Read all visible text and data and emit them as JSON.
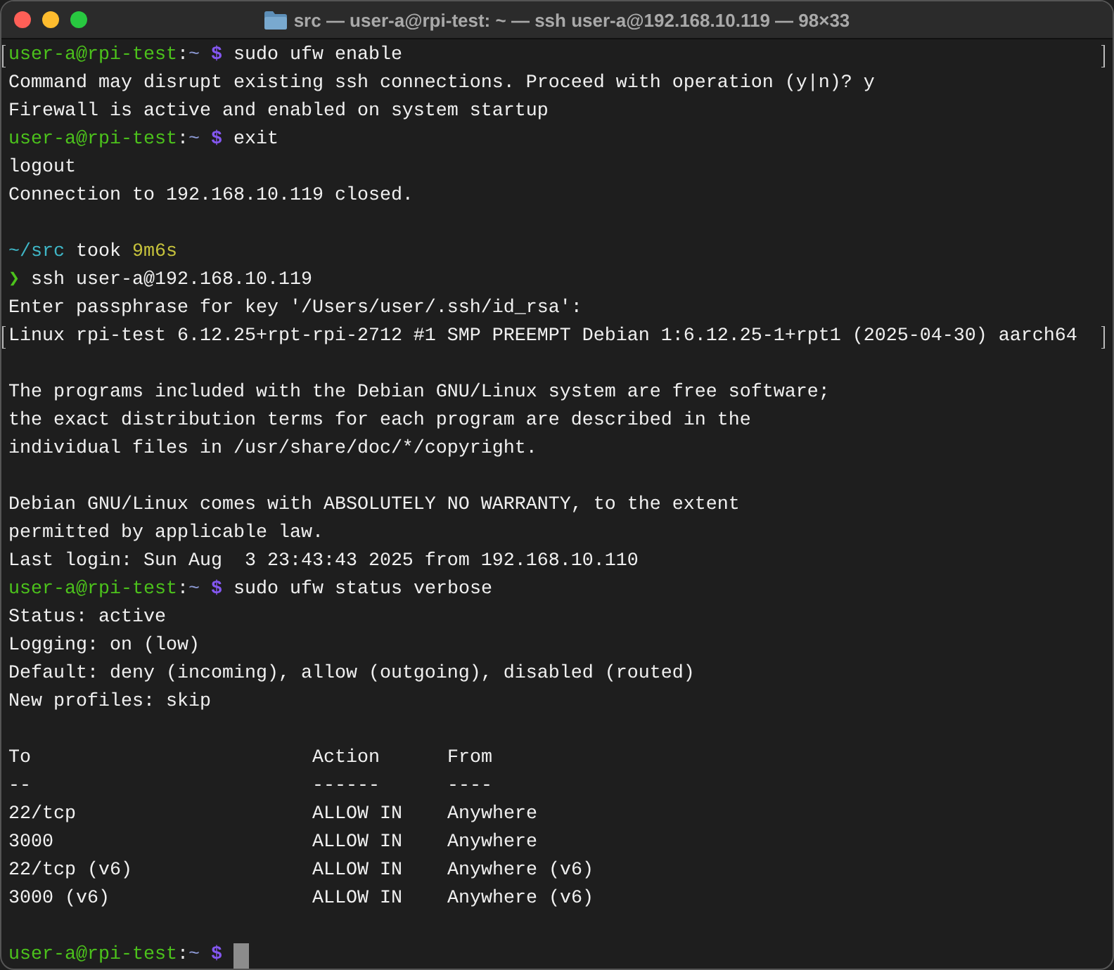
{
  "window": {
    "title": "src — user-a@rpi-test: ~ — ssh user-a@192.168.10.119 — 98×33"
  },
  "blocks": [
    {
      "kind": "text",
      "lines": [
        {
          "marked": true,
          "segments": [
            {
              "kind": "host",
              "text": "user-a@rpi-test"
            },
            {
              "kind": "sep",
              "text": ":"
            },
            {
              "kind": "path",
              "text": "~"
            },
            {
              "kind": "sign",
              "text": "$"
            },
            {
              "kind": "text",
              "text": "sudo ufw enable"
            }
          ]
        },
        {
          "segments": [
            {
              "kind": "text",
              "text": "Command may disrupt existing ssh connections. Proceed with operation (y|n)? y"
            }
          ]
        },
        {
          "segments": [
            {
              "kind": "text",
              "text": "Firewall is active and enabled on system startup"
            }
          ]
        },
        {
          "segments": [
            {
              "kind": "host",
              "text": "user-a@rpi-test"
            },
            {
              "kind": "sep",
              "text": ":"
            },
            {
              "kind": "path",
              "text": "~"
            },
            {
              "kind": "sign",
              "text": "$"
            },
            {
              "kind": "text",
              "text": "exit"
            }
          ]
        },
        {
          "segments": [
            {
              "kind": "text",
              "text": "logout"
            }
          ]
        },
        {
          "segments": [
            {
              "kind": "text",
              "text": "Connection to 192.168.10.119 closed."
            }
          ]
        }
      ]
    },
    {
      "kind": "text",
      "lines": [
        {
          "segments": [
            {
              "kind": "dir",
              "text": "~/src"
            },
            {
              "kind": "text",
              "text": "took"
            },
            {
              "kind": "duration",
              "text": "9m6s"
            }
          ]
        },
        {
          "segments": [
            {
              "kind": "chevron",
              "text": "❯"
            },
            {
              "kind": "text",
              "text": "ssh user-a@192.168.10.119"
            }
          ]
        },
        {
          "segments": [
            {
              "kind": "text",
              "text": "Enter passphrase for key '/Users/user/.ssh/id_rsa':"
            }
          ]
        },
        {
          "marked": true,
          "segments": [
            {
              "kind": "text",
              "text": "Linux rpi-test 6.12.25+rpt-rpi-2712 #1 SMP PREEMPT Debian 1:6.12.25-1+rpt1 (2025-04-30) aarch64"
            }
          ]
        }
      ]
    },
    {
      "kind": "text",
      "lines": [
        {
          "segments": [
            {
              "kind": "text",
              "text": "The programs included with the Debian GNU/Linux system are free software;"
            }
          ]
        },
        {
          "segments": [
            {
              "kind": "text",
              "text": "the exact distribution terms for each program are described in the"
            }
          ]
        },
        {
          "segments": [
            {
              "kind": "text",
              "text": "individual files in /usr/share/doc/*/copyright."
            }
          ]
        }
      ]
    },
    {
      "kind": "text",
      "lines": [
        {
          "segments": [
            {
              "kind": "text",
              "text": "Debian GNU/Linux comes with ABSOLUTELY NO WARRANTY, to the extent"
            }
          ]
        },
        {
          "segments": [
            {
              "kind": "text",
              "text": "permitted by applicable law."
            }
          ]
        },
        {
          "segments": [
            {
              "kind": "text",
              "text": "Last login: Sun Aug  3 23:43:43 2025 from 192.168.10.110"
            }
          ]
        },
        {
          "segments": [
            {
              "kind": "host",
              "text": "user-a@rpi-test"
            },
            {
              "kind": "sep",
              "text": ":"
            },
            {
              "kind": "path",
              "text": "~"
            },
            {
              "kind": "sign",
              "text": "$"
            },
            {
              "kind": "text",
              "text": "sudo ufw status verbose"
            }
          ]
        },
        {
          "segments": [
            {
              "kind": "text",
              "text": "Status: active"
            }
          ]
        },
        {
          "segments": [
            {
              "kind": "text",
              "text": "Logging: on (low)"
            }
          ]
        },
        {
          "segments": [
            {
              "kind": "text",
              "text": "Default: deny (incoming), allow (outgoing), disabled (routed)"
            }
          ]
        },
        {
          "segments": [
            {
              "kind": "text",
              "text": "New profiles: skip"
            }
          ]
        }
      ]
    },
    {
      "kind": "table",
      "columns": [
        "To",
        "Action",
        "From"
      ],
      "rows": [
        [
          "--",
          "------",
          "----"
        ],
        [
          "22/tcp",
          "ALLOW IN",
          "Anywhere"
        ],
        [
          "3000",
          "ALLOW IN",
          "Anywhere"
        ],
        [
          "22/tcp (v6)",
          "ALLOW IN",
          "Anywhere (v6)"
        ],
        [
          "3000 (v6)",
          "ALLOW IN",
          "Anywhere (v6)"
        ]
      ]
    },
    {
      "kind": "text",
      "lines": [
        {
          "cursor": true,
          "segments": [
            {
              "kind": "host",
              "text": "user-a@rpi-test"
            },
            {
              "kind": "sep",
              "text": ":"
            },
            {
              "kind": "path",
              "text": "~"
            },
            {
              "kind": "sign",
              "text": "$"
            }
          ]
        }
      ]
    }
  ]
}
